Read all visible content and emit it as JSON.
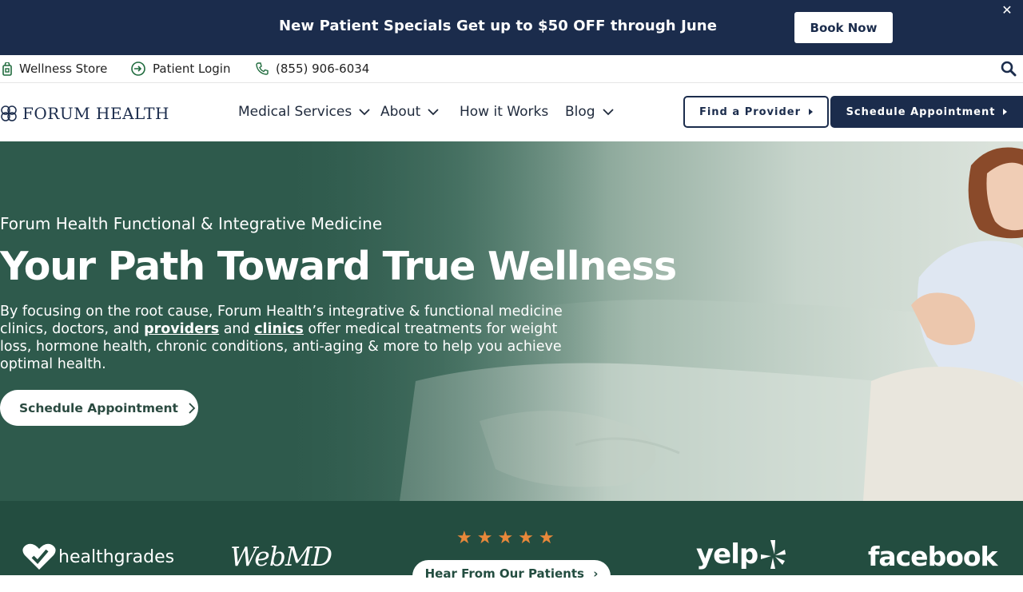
{
  "promo": {
    "text": "New Patient Specials Get up to $50 OFF through June",
    "button": "Book Now",
    "close": "✕"
  },
  "utility": {
    "store": "Wellness Store",
    "login": "Patient Login",
    "phone": "(855) 906-6034"
  },
  "nav": {
    "logo": "FORUM HEALTH",
    "items": [
      {
        "label": "Medical Services"
      },
      {
        "label": "About"
      },
      {
        "label": "How it Works"
      },
      {
        "label": "Blog"
      }
    ],
    "find_provider": "Find a Provider",
    "schedule": "Schedule Appointment"
  },
  "hero": {
    "eyebrow": "Forum Health Functional & Integrative Medicine",
    "title": "Your Path Toward True Wellness",
    "body_pre": "By focusing on the root cause, Forum Health’s integrative & functional medicine clinics, doctors, and ",
    "link_providers": "providers",
    "body_mid": " and ",
    "link_clinics": "clinics",
    "body_post": " offer medical treatments for weight loss, hormone health, chronic conditions, anti-aging & more to help you achieve optimal health.",
    "cta": "Schedule Appointment"
  },
  "reviews": {
    "healthgrades": "healthgrades",
    "webmd": "WebMD",
    "stars": "★★★★★",
    "hear": "Hear From Our Patients",
    "yelp": "yelp",
    "facebook": "facebook"
  },
  "colors": {
    "navy": "#1b2c4c",
    "hero_green": "#2e5a4c",
    "footer_green": "#234d40",
    "star": "#e8883a"
  }
}
